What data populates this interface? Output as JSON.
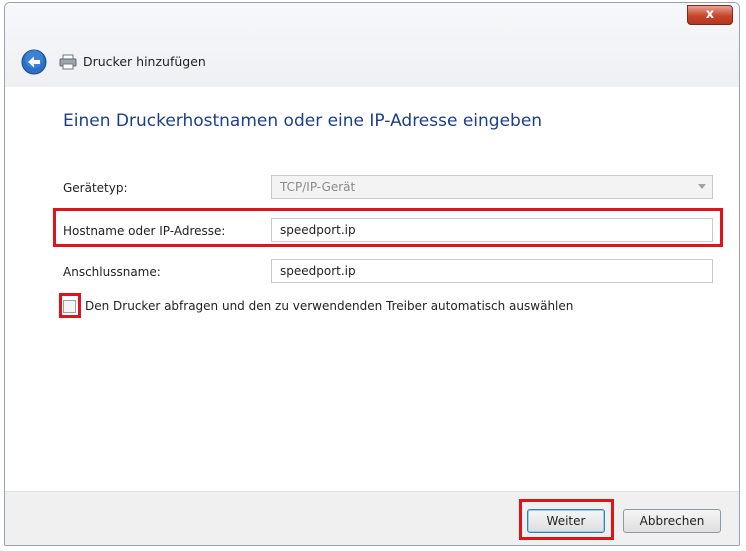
{
  "window": {
    "title": "Drucker hinzufügen",
    "close_label": "x"
  },
  "heading": "Einen Druckerhostnamen oder eine IP-Adresse eingeben",
  "form": {
    "device_type": {
      "label": "Gerätetyp:",
      "value": "TCP/IP-Gerät"
    },
    "hostname": {
      "label": "Hostname oder IP-Adresse:",
      "value": "speedport.ip"
    },
    "port_name": {
      "label": "Anschlussname:",
      "value": "speedport.ip"
    },
    "auto_driver": {
      "label": "Den Drucker abfragen und den zu verwendenden Treiber automatisch auswählen",
      "checked": false
    }
  },
  "footer": {
    "next_label": "Weiter",
    "cancel_label": "Abbrechen"
  },
  "colors": {
    "highlight": "#e0131b",
    "heading": "#1b3f8b",
    "back_button": "#2a6fc9"
  },
  "icons": {
    "back": "back-arrow-icon",
    "printer": "printer-icon",
    "close": "close-icon",
    "dropdown": "chevron-down-icon"
  }
}
